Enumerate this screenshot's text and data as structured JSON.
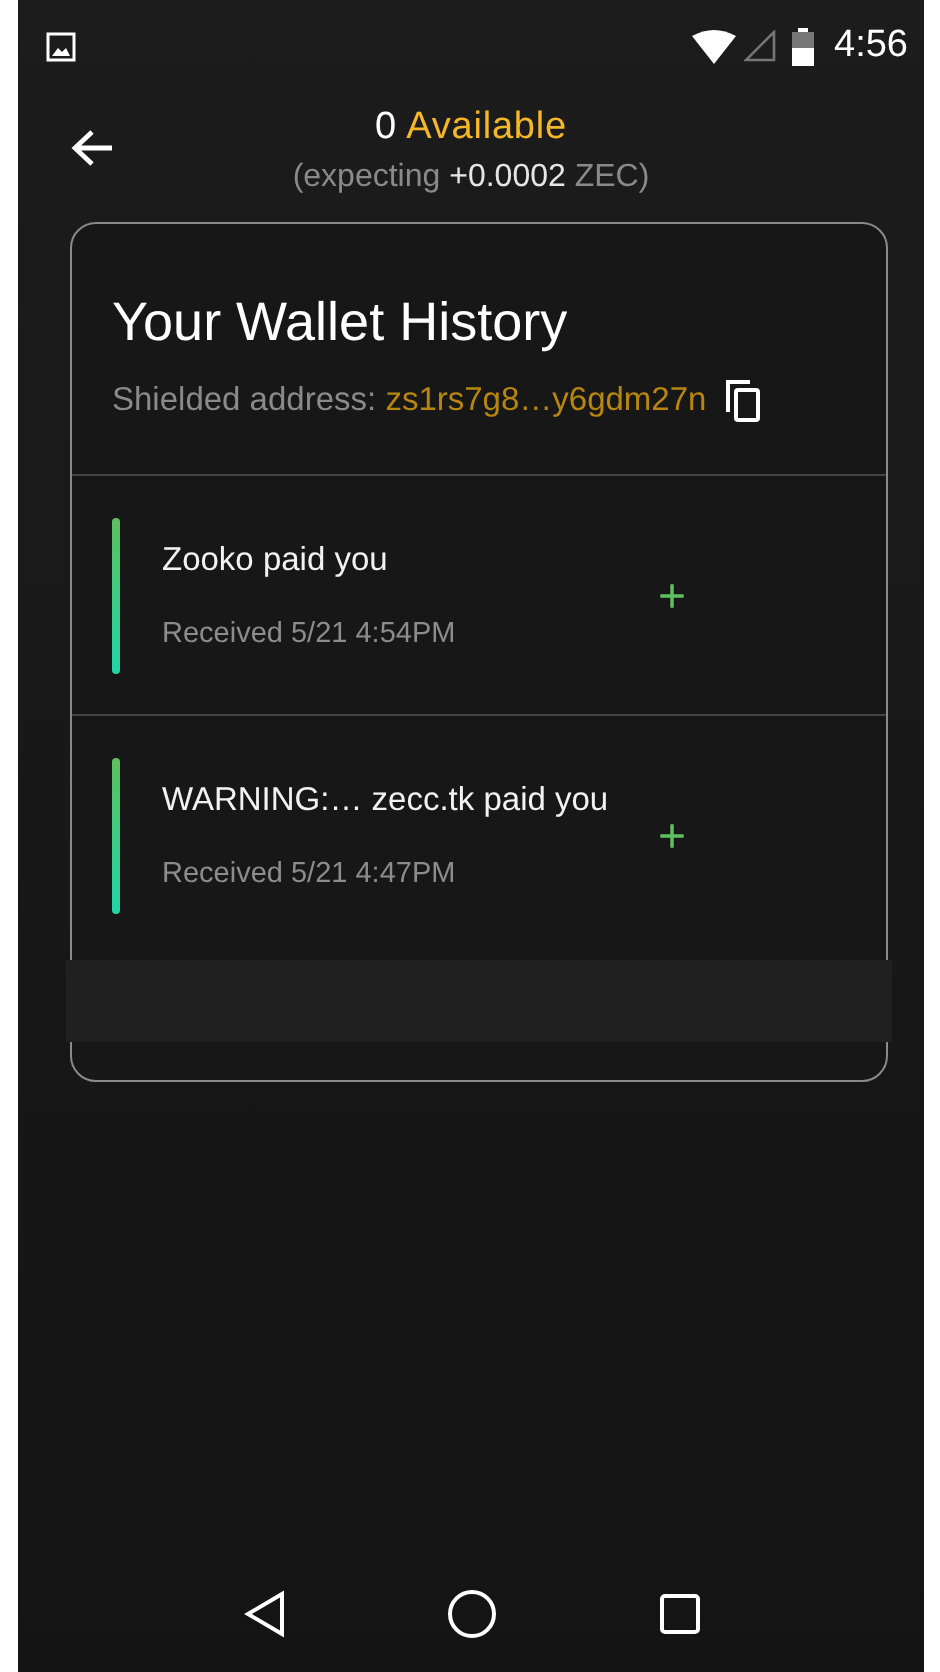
{
  "status_bar": {
    "time": "4:56"
  },
  "header": {
    "balance": "0",
    "balance_label": "Available",
    "expecting_prefix": "(expecting",
    "expecting_amount": "+0.0002",
    "expecting_unit": "ZEC)"
  },
  "history": {
    "title": "Your Wallet History",
    "address_label": "Shielded address:",
    "address": "zs1rs7g8…y6gdm27n",
    "transactions": [
      {
        "title": "Zooko paid you",
        "detail": "Received 5/21 4:54PM",
        "sign": "+"
      },
      {
        "title": "WARNING:… zecc.tk paid you",
        "detail": "Received 5/21 4:47PM",
        "sign": "+"
      }
    ]
  }
}
